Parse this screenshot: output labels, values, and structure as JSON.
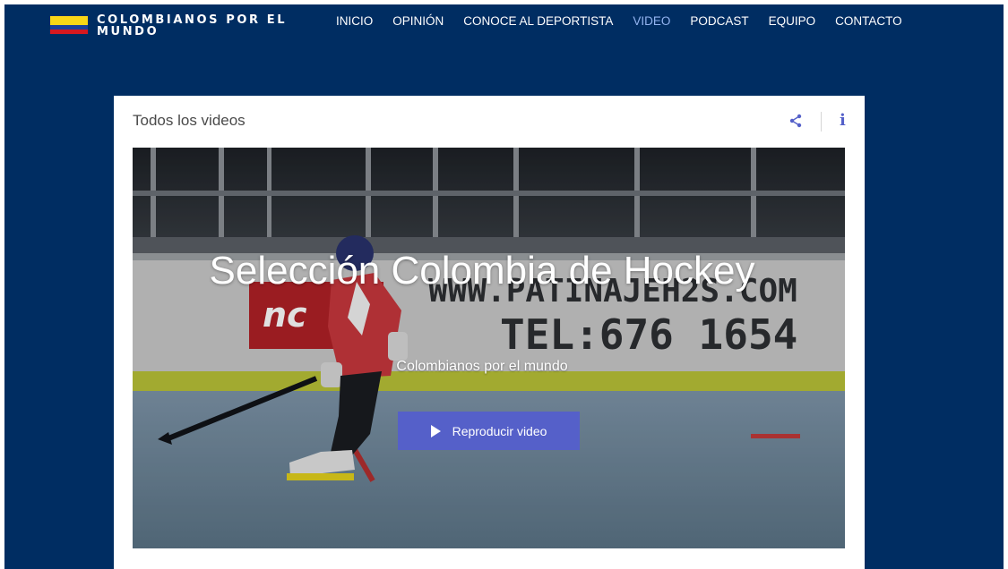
{
  "header": {
    "brand": "COLOMBIANOS POR EL MUNDO",
    "nav": [
      {
        "label": "INICIO",
        "active": false
      },
      {
        "label": "OPINIÓN",
        "active": false
      },
      {
        "label": "CONOCE AL DEPORTISTA",
        "active": false
      },
      {
        "label": "VIDEO",
        "active": true
      },
      {
        "label": "PODCAST",
        "active": false
      },
      {
        "label": "EQUIPO",
        "active": false
      },
      {
        "label": "CONTACTO",
        "active": false
      }
    ]
  },
  "card": {
    "title": "Todos los videos",
    "icons": [
      "share-icon",
      "info-icon"
    ],
    "info_glyph": "i"
  },
  "video": {
    "title": "Selección Colombia de Hockey",
    "subtitle": "Colombianos por el mundo",
    "play_label": "Reproducir video",
    "banner_text_1": "WWW.PATINAJEH2S.COM",
    "banner_text_2": "TEL:676 1654"
  },
  "colors": {
    "background": "#002d62",
    "accent": "#5560c9",
    "nav_active": "#93b4f0",
    "flag_yellow": "#f9d616",
    "flag_blue": "#1b3f9a",
    "flag_red": "#d71920"
  }
}
